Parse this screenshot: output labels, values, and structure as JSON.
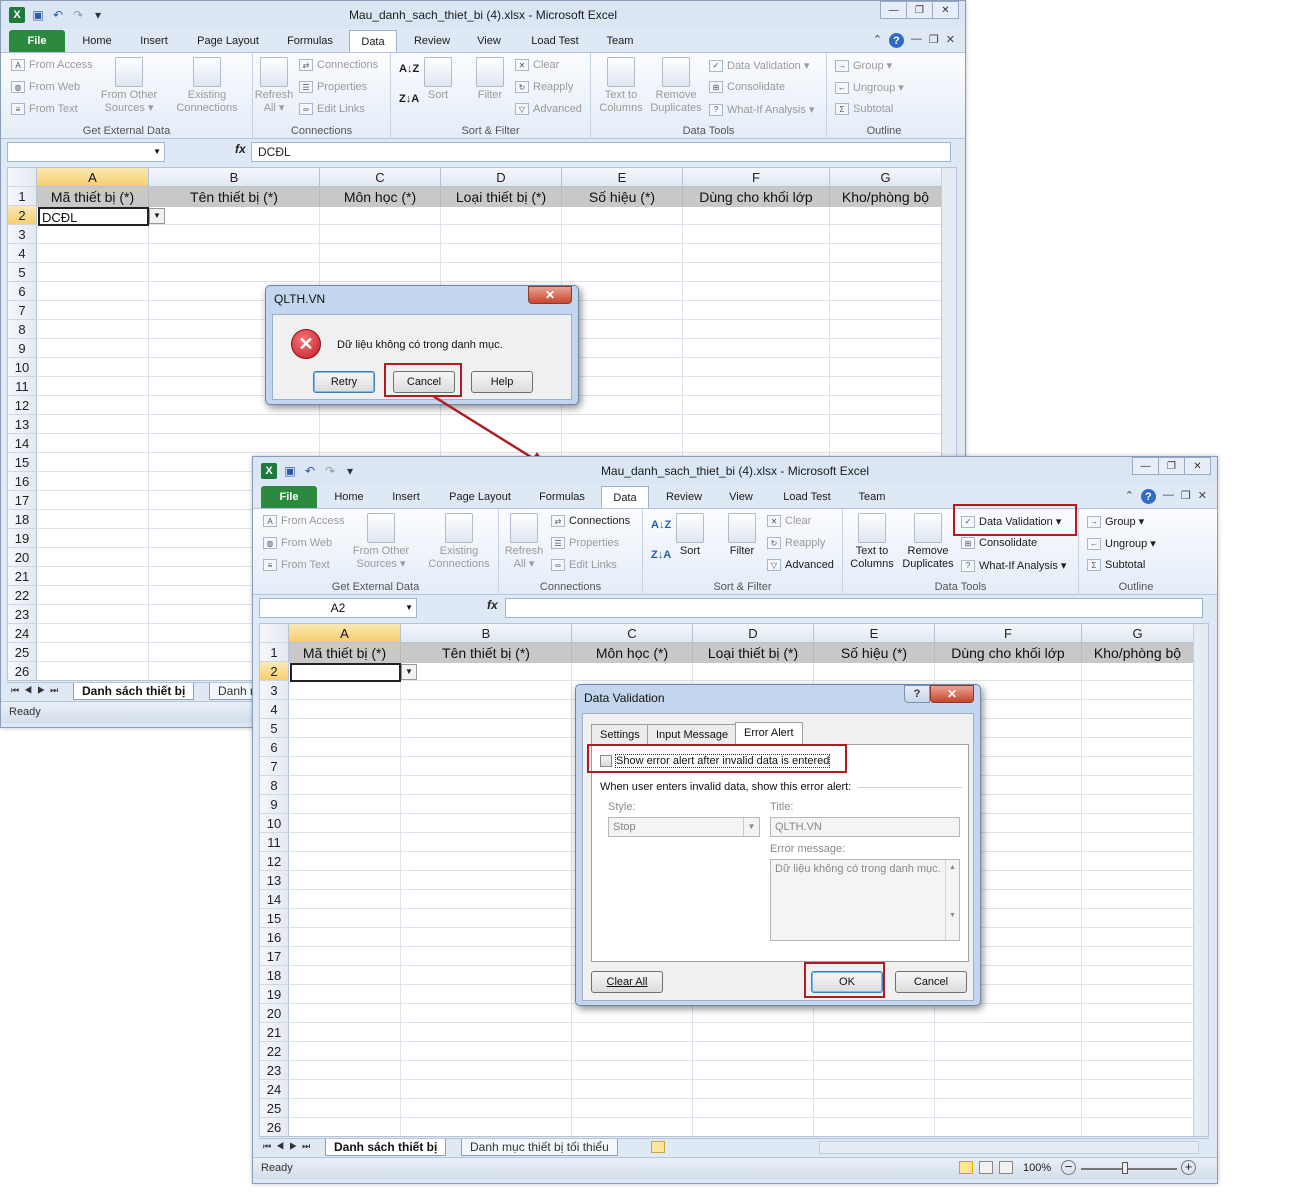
{
  "app": {
    "title1": "Mau_danh_sach_thiet_bi (4).xlsx  -  Microsoft Excel",
    "title2": "Mau_danh_sach_thiet_bi (4).xlsx  -  Microsoft Excel",
    "tabs": [
      "File",
      "Home",
      "Insert",
      "Page Layout",
      "Formulas",
      "Data",
      "Review",
      "View",
      "Load Test",
      "Team"
    ]
  },
  "ribbon": {
    "from_access": "From Access",
    "from_web": "From Web",
    "from_text": "From Text",
    "from_other_1": "From Other",
    "from_other_2": "Sources ▾",
    "existing_1": "Existing",
    "existing_2": "Connections",
    "get_external": "Get External Data",
    "refresh_1": "Refresh",
    "refresh_2": "All ▾",
    "connections": "Connections",
    "properties": "Properties",
    "edit_links": "Edit Links",
    "connections_group": "Connections",
    "sort": "Sort",
    "filter": "Filter",
    "clear": "Clear",
    "reapply": "Reapply",
    "advanced": "Advanced",
    "sort_filter": "Sort & Filter",
    "text_to_1": "Text to",
    "text_to_2": "Columns",
    "remove_1": "Remove",
    "remove_2": "Duplicates",
    "data_validation": "Data Validation ▾",
    "consolidate": "Consolidate",
    "what_if": "What-If Analysis ▾",
    "data_tools": "Data Tools",
    "group": "Group ▾",
    "ungroup": "Ungroup ▾",
    "subtotal": "Subtotal",
    "outline": "Outline"
  },
  "formula1": {
    "name": "",
    "fx": "fx",
    "value": "DCĐL"
  },
  "formula2": {
    "name": "A2",
    "fx": "fx",
    "value": ""
  },
  "columns": [
    "A",
    "B",
    "C",
    "D",
    "E",
    "F",
    "G"
  ],
  "headers": [
    "Mã thiết bị (*)",
    "Tên thiết bị (*)",
    "Môn học (*)",
    "Loại thiết bị (*)",
    "Số hiệu (*)",
    "Dùng cho khối lớp",
    "Kho/phòng bộ"
  ],
  "cell_a2_1": "DCĐL",
  "rows1": [
    "1",
    "2",
    "3",
    "4",
    "5",
    "6",
    "7",
    "8",
    "9",
    "10",
    "11",
    "12",
    "13",
    "14",
    "15",
    "16",
    "17",
    "18",
    "19",
    "20",
    "21",
    "22",
    "23",
    "24",
    "25",
    "26"
  ],
  "rows2": [
    "1",
    "2",
    "3",
    "4",
    "5",
    "6",
    "7",
    "8",
    "9",
    "10",
    "11",
    "12",
    "13",
    "14",
    "15",
    "16",
    "17",
    "18",
    "19",
    "20",
    "21",
    "22",
    "23",
    "24",
    "25",
    "26"
  ],
  "sheets": {
    "tab1": "Danh sách thiết bị",
    "tab2_partial": "Danh m",
    "tab2": "Danh mục thiết bị tối thiểu"
  },
  "status": {
    "ready": "Ready",
    "zoom": "100%"
  },
  "error_dialog": {
    "title": "QLTH.VN",
    "message": "Dữ liệu không có trong danh mục.",
    "retry": "Retry",
    "cancel": "Cancel",
    "help": "Help"
  },
  "dv_dialog": {
    "title": "Data Validation",
    "tab_settings": "Settings",
    "tab_input": "Input Message",
    "tab_error": "Error Alert",
    "checkbox_label": "Show error alert after invalid data is entered",
    "instruction": "When user enters invalid data, show this error alert:",
    "style_label": "Style:",
    "style_value": "Stop",
    "title_label": "Title:",
    "title_value": "QLTH.VN",
    "message_label": "Error message:",
    "message_value": "Dữ liệu không có trong danh mục.",
    "clear_all": "Clear All",
    "ok": "OK",
    "cancel": "Cancel"
  },
  "colors": {
    "file_tab": "#2b8a3e",
    "highlight": "#b01c22",
    "selected_header": "#f6cf6e"
  }
}
